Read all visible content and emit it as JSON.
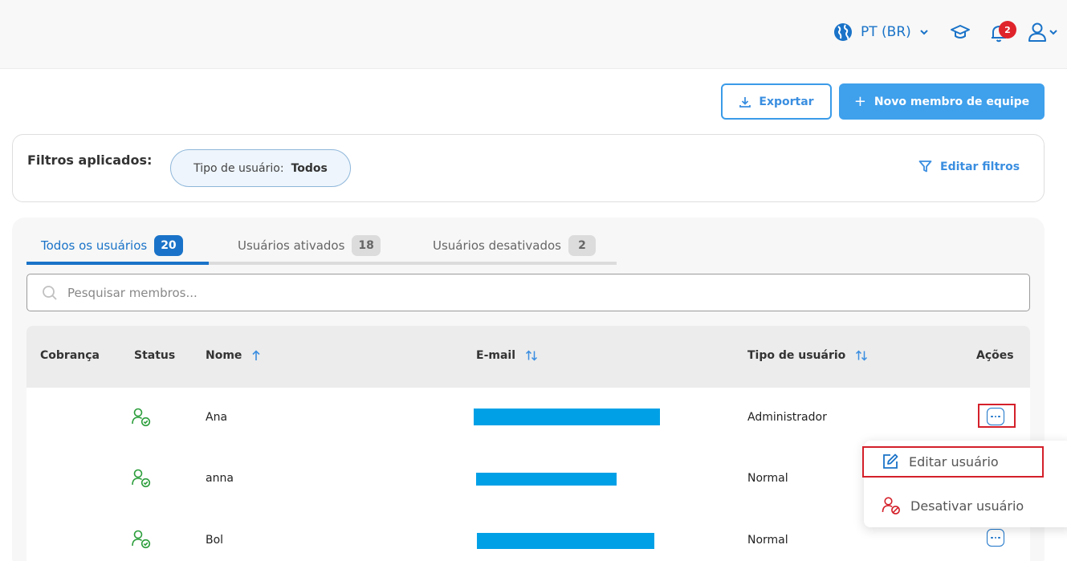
{
  "header": {
    "language": "PT (BR)",
    "notification_count": "2"
  },
  "actions": {
    "export_label": "Exportar",
    "new_member_label": "Novo membro de equipe"
  },
  "filters": {
    "label": "Filtros aplicados:",
    "chip_key": "Tipo de usuário:",
    "chip_value": "Todos",
    "edit_label": "Editar filtros"
  },
  "tabs": [
    {
      "label": "Todos os usuários",
      "count": "20"
    },
    {
      "label": "Usuários ativados",
      "count": "18"
    },
    {
      "label": "Usuários desativados",
      "count": "2"
    }
  ],
  "search": {
    "placeholder": "Pesquisar membros..."
  },
  "table": {
    "columns": {
      "billing": "Cobrança",
      "status": "Status",
      "name": "Nome",
      "email": "E-mail",
      "user_type": "Tipo de usuário",
      "actions": "Ações"
    },
    "rows": [
      {
        "name": "Ana",
        "user_type": "Administrador",
        "status": "active"
      },
      {
        "name": "anna",
        "user_type": "Normal",
        "status": "active"
      },
      {
        "name": "Bol",
        "user_type": "Normal",
        "status": "active"
      }
    ]
  },
  "row_menu": {
    "edit_label": "Editar usuário",
    "deactivate_label": "Desativar usuário"
  },
  "colors": {
    "primary": "#1a73c8",
    "button_blue": "#3fa0ec",
    "active_green": "#2a9d3a",
    "danger_red": "#d4202a",
    "redaction": "#00a0e6"
  }
}
